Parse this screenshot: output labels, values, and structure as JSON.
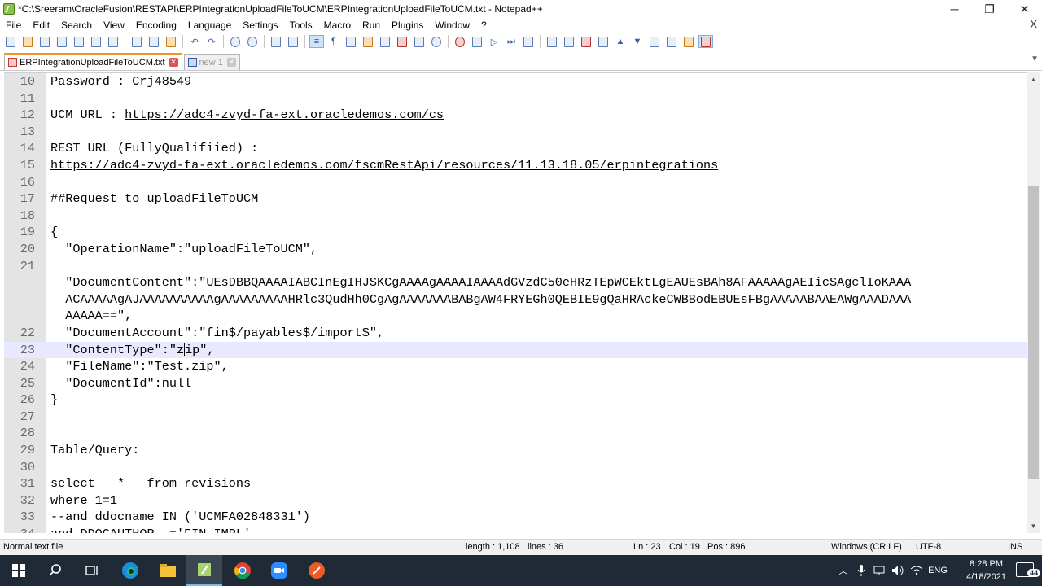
{
  "window": {
    "title": "*C:\\Sreeram\\OracleFusion\\RESTAPI\\ERPIntegrationUploadFileToUCM\\ERPIntegrationUploadFileToUCM.txt - Notepad++",
    "minimize": "─",
    "restore": "❐",
    "close": "✕"
  },
  "menu": {
    "items": [
      "File",
      "Edit",
      "Search",
      "View",
      "Encoding",
      "Language",
      "Settings",
      "Tools",
      "Macro",
      "Run",
      "Plugins",
      "Window",
      "?"
    ],
    "close": "X"
  },
  "tabs": [
    {
      "label": "ERPIntegrationUploadFileToUCM.txt",
      "active": true
    },
    {
      "label": "new 1",
      "active": false
    }
  ],
  "editor": {
    "lines": [
      {
        "num": "10",
        "text": "Password : Crj48549"
      },
      {
        "num": "11",
        "text": ""
      },
      {
        "num": "12",
        "text": "UCM URL : ",
        "link": "https://adc4-zvyd-fa-ext.oracledemos.com/cs"
      },
      {
        "num": "13",
        "text": ""
      },
      {
        "num": "14",
        "text": "REST URL (FullyQualifiied) :"
      },
      {
        "num": "15",
        "text": "",
        "link": "https://adc4-zvyd-fa-ext.oracledemos.com/fscmRestApi/resources/11.13.18.05/erpintegrations"
      },
      {
        "num": "16",
        "text": ""
      },
      {
        "num": "17",
        "text": "##Request to uploadFileToUCM"
      },
      {
        "num": "18",
        "text": ""
      },
      {
        "num": "19",
        "text": "{"
      },
      {
        "num": "20",
        "text": "  \"OperationName\":\"uploadFileToUCM\","
      },
      {
        "num": "21",
        "text": ""
      },
      {
        "num": "",
        "text": "  \"DocumentContent\":\"UEsDBBQAAAAIABCInEgIHJSKCgAAAAgAAAAIAAAAdGVzdC50eHRzTEpWCEktLgEAUEsBAh8AFAAAAAgAEIicSAgclIoKAAA"
      },
      {
        "num": "",
        "text": "  ACAAAAAgAJAAAAAAAAAAgAAAAAAAAAHRlc3QudHh0CgAgAAAAAAABABgAW4FRYEGh0QEBIE9gQaHRAckeCWBBodEBUEsFBgAAAAABAAEAWgAAADAAA"
      },
      {
        "num": "",
        "text": "  AAAAA==\","
      },
      {
        "num": "22",
        "text": "  \"DocumentAccount\":\"fin$/payables$/import$\","
      },
      {
        "num": "23",
        "text": "  \"ContentType\":\"zip\",",
        "current": true
      },
      {
        "num": "24",
        "text": "  \"FileName\":\"Test.zip\","
      },
      {
        "num": "25",
        "text": "  \"DocumentId\":null"
      },
      {
        "num": "26",
        "text": "}"
      },
      {
        "num": "27",
        "text": ""
      },
      {
        "num": "28",
        "text": ""
      },
      {
        "num": "29",
        "text": "Table/Query:"
      },
      {
        "num": "30",
        "text": ""
      },
      {
        "num": "31",
        "text": "select   *   from revisions"
      },
      {
        "num": "32",
        "text": "where 1=1"
      },
      {
        "num": "33",
        "text": "--and ddocname IN ('UCMFA02848331')"
      },
      {
        "num": "34",
        "text": "and DDOCAUTHOR  ='FIN_IMPL'"
      }
    ]
  },
  "status": {
    "filetype": "Normal text file",
    "length": "length : 1,108",
    "lines": "lines : 36",
    "ln": "Ln : 23",
    "col": "Col : 19",
    "pos": "Pos : 896",
    "eol": "Windows (CR LF)",
    "encoding": "UTF-8",
    "mode": "INS"
  },
  "taskbar": {
    "time": "8:28 PM",
    "date": "4/18/2021",
    "language": "ENG",
    "notifications": "44"
  },
  "colors": {
    "gutter": "#e4e4e4",
    "current_line": "#e8e8ff",
    "taskbar": "#1f2a36"
  }
}
